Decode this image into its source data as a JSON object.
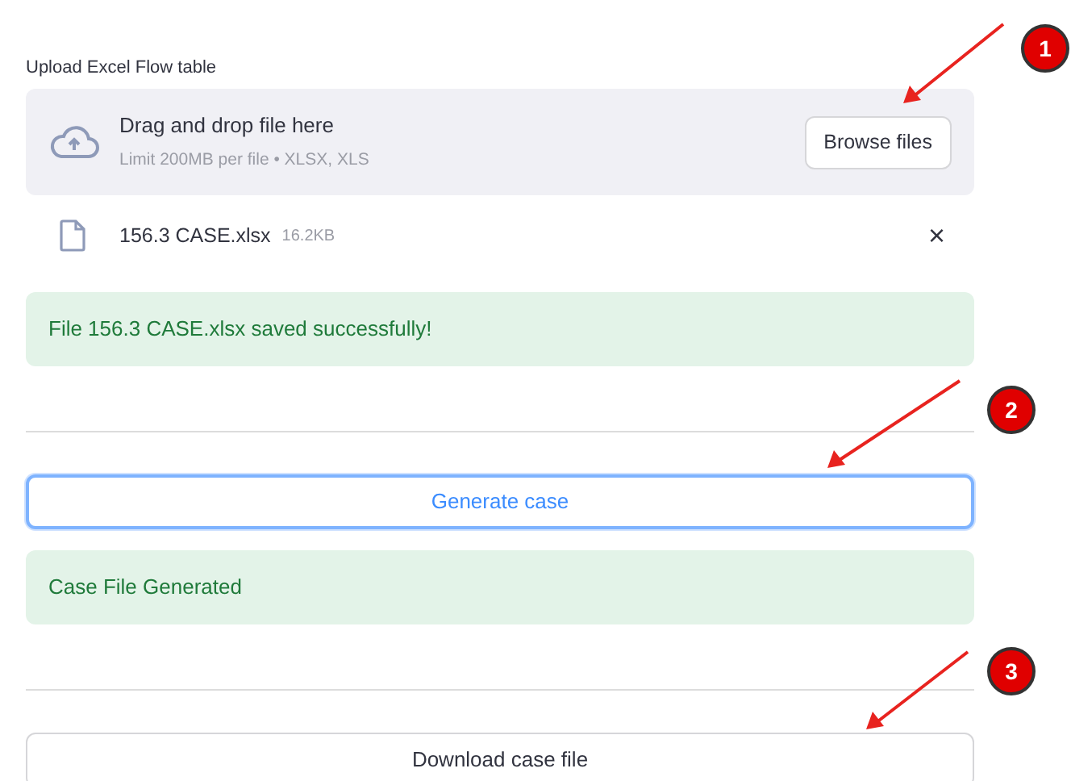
{
  "uploader": {
    "label": "Upload Excel Flow table",
    "dropzone_title": "Drag and drop file here",
    "dropzone_hint": "Limit 200MB per file • XLSX, XLS",
    "browse_button": "Browse files"
  },
  "uploaded_file": {
    "name": "156.3 CASE.xlsx",
    "size": "16.2KB",
    "remove": "×"
  },
  "blocks": [
    {
      "kind": "alert",
      "text": "File 156.3 CASE.xlsx saved successfully!"
    },
    {
      "kind": "divider"
    },
    {
      "kind": "button",
      "label": "Generate case",
      "focused": true
    },
    {
      "kind": "alert",
      "text": "Case File Generated"
    },
    {
      "kind": "divider"
    },
    {
      "kind": "button",
      "label": "Download case file",
      "focused": false
    }
  ],
  "callouts": [
    {
      "number": "1"
    },
    {
      "number": "2"
    },
    {
      "number": "3"
    }
  ]
}
